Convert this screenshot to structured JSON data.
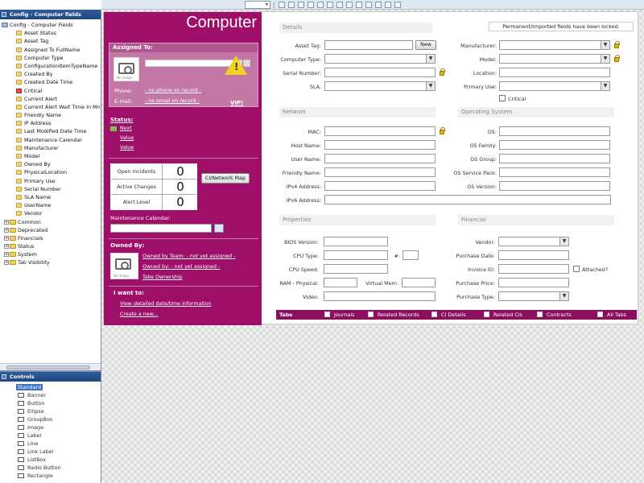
{
  "config_panel": {
    "title": "Config - Computer fields",
    "root": "Config - Computer Fields",
    "fields": [
      "Asset Status",
      "Asset Tag",
      "Assigned To FullName",
      "Computer Type",
      "ConfigurationItemTypeName",
      "Created By",
      "Created Date Time",
      "Critical",
      "Current Alert",
      "Current Alert Wait Time In Mn",
      "Friendly Name",
      "IP Address",
      "Last Modified Date Time",
      "Maintenance Calendar",
      "Manufacturer",
      "Model",
      "Owned By",
      "PhysicalLocation",
      "Primary Use",
      "Serial Number",
      "SLA Name",
      "UserName",
      "Vendor"
    ],
    "groups": [
      "Common",
      "Deprecated",
      "Financials",
      "Status",
      "System",
      "Tab Visibility"
    ]
  },
  "controls_panel": {
    "title": "Controls",
    "items": [
      "Standard",
      "Banner",
      "Button",
      "Ellipse",
      "GroupBox",
      "Image",
      "Label",
      "Line",
      "Link Label",
      "ListBox",
      "Radio Button",
      "Rectangle"
    ]
  },
  "form": {
    "title": "Computer",
    "assigned": {
      "header": "Assigned To:",
      "phone_label": "Phone:",
      "phone_value": "- no phone on record -",
      "email_label": "E-mail:",
      "email_value": "- no email on record -",
      "vip": "VIP!",
      "no_image": "No image"
    },
    "status": {
      "header": "Status:",
      "items": [
        "Next",
        "Value",
        "Value"
      ]
    },
    "counters": [
      {
        "label": "Open Incidents",
        "value": "0"
      },
      {
        "label": "Active Changes",
        "value": "0"
      },
      {
        "label": "Alert Level",
        "value": "0"
      }
    ],
    "cinet_button": "CI/Network Map",
    "maintenance_label": "Maintenance Calendar:",
    "owned": {
      "header": "Owned By:",
      "team": "Owned by Team: - not yet assigned -",
      "user": "Owned by: - not yet assigned -",
      "take": "Take Ownership"
    },
    "iwant": {
      "header": "I want to:",
      "links": [
        "View detailed date/time information",
        "Create a new..."
      ]
    },
    "notice": "Permanent/imported fields have been locked.",
    "sections": {
      "details": "Details",
      "network": "Network",
      "os": "Operating System",
      "properties": "Properties",
      "financial": "Financial"
    },
    "details_left": [
      "Asset Tag:",
      "Computer Type:",
      "Serial Number:",
      "SLA:"
    ],
    "new_button": "New",
    "details_right": [
      "Manufacturer:",
      "Model:",
      "Location:",
      "Primary Use:"
    ],
    "critical_label": "Critical",
    "network_fields": [
      "MAC:",
      "Host Name:",
      "User Name:",
      "Friendly Name:",
      "IPv4 Address:",
      "IPv6 Address:"
    ],
    "os_fields": [
      "OS:",
      "OS Family:",
      "OS Group:",
      "OS Service Pack:",
      "OS Version:"
    ],
    "prop_fields": [
      "BIOS Version:",
      "CPU Type:",
      "CPU Speed:",
      "RAM - Physical:",
      "Video:"
    ],
    "virtual_mem": "Virtual Mem:",
    "hash": "#:",
    "fin_fields": [
      "Vendor:",
      "Purchase Date:",
      "Invoice ID:",
      "Purchase Price:",
      "Purchase Type:"
    ],
    "attached": "Attached?",
    "tabs": [
      "Tabs",
      "Journals",
      "Related Records",
      "CI Details",
      "Related CIs",
      "Contracts",
      "All Tabs"
    ]
  }
}
